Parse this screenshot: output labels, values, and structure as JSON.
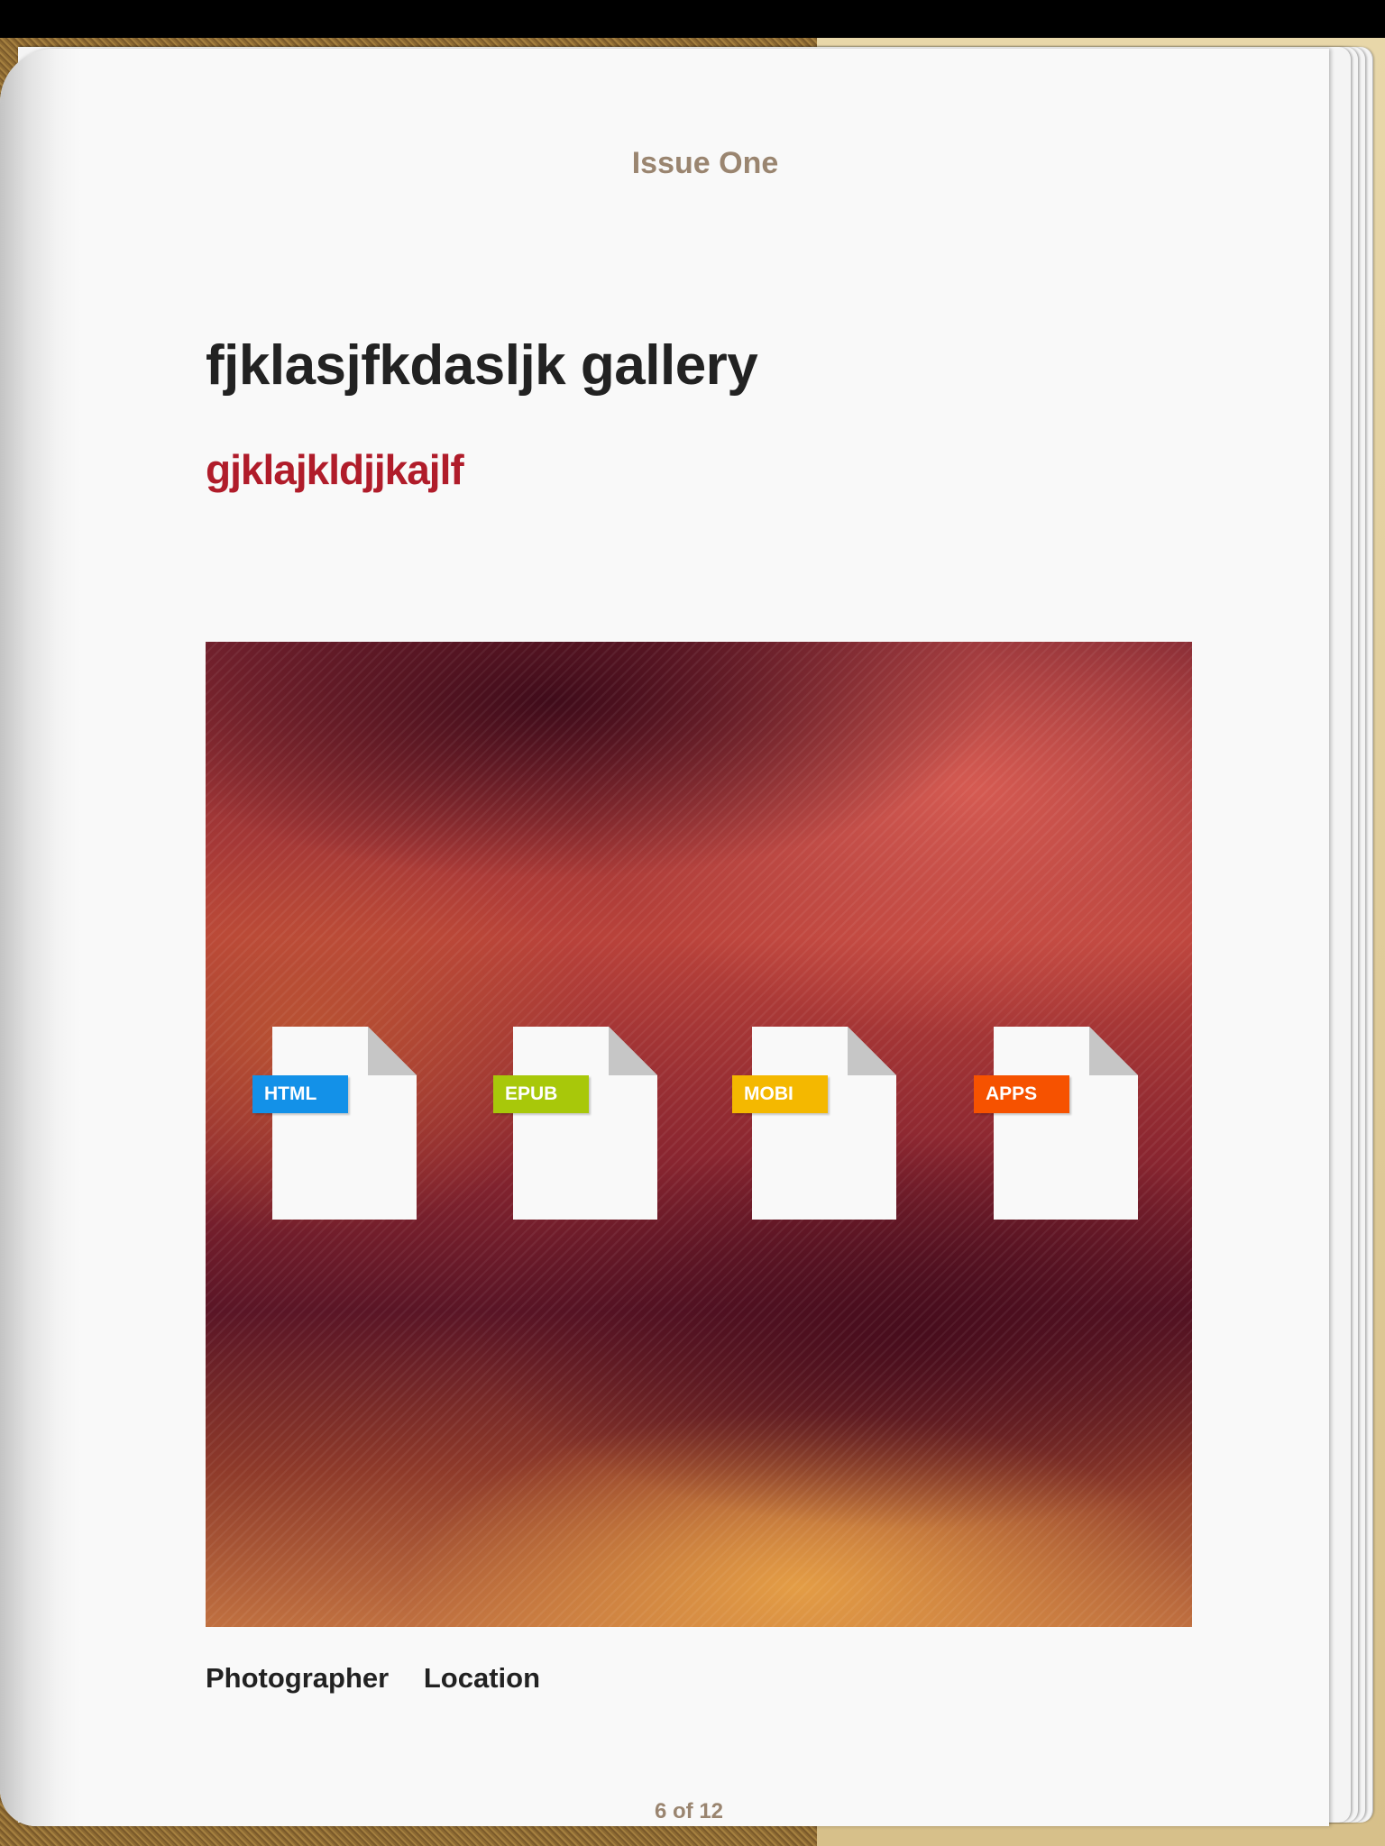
{
  "header": {
    "issue": "Issue One"
  },
  "article": {
    "title": "fjklasjfkdasljk gallery",
    "subtitle": "gjklajkldjjkajlf"
  },
  "gallery": {
    "files": [
      {
        "label": "HTML",
        "color": "#1391e8",
        "icon": "html-file-icon"
      },
      {
        "label": "EPUB",
        "color": "#a8c80a",
        "icon": "epub-file-icon"
      },
      {
        "label": "MOBI",
        "color": "#f4b800",
        "icon": "mobi-file-icon"
      },
      {
        "label": "APPS",
        "color": "#f65200",
        "icon": "apps-file-icon"
      }
    ]
  },
  "credits": {
    "photographer": "Photographer",
    "location": "Location"
  },
  "footer": {
    "page_indicator": "6 of 12"
  },
  "colors": {
    "title": "#222222",
    "subtitle": "#b01c2a",
    "meta": "#9a8570"
  }
}
